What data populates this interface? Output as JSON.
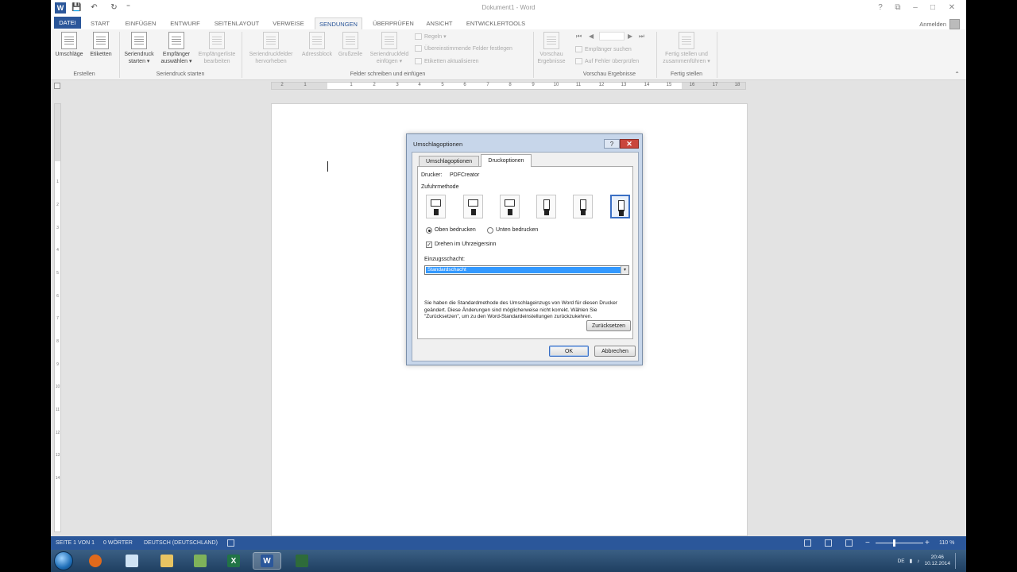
{
  "window": {
    "title": "Dokument1 - Word",
    "signin": "Anmelden",
    "word_logo": "W",
    "qat": [
      "save-icon",
      "undo-icon",
      "redo-icon",
      "customize-icon"
    ]
  },
  "tabs": [
    {
      "label": "DATEI"
    },
    {
      "label": "START"
    },
    {
      "label": "EINFÜGEN"
    },
    {
      "label": "ENTWURF"
    },
    {
      "label": "SEITENLAYOUT"
    },
    {
      "label": "VERWEISE"
    },
    {
      "label": "SENDUNGEN"
    },
    {
      "label": "ÜBERPRÜFEN"
    },
    {
      "label": "ANSICHT"
    },
    {
      "label": "ENTWICKLERTOOLS"
    }
  ],
  "ribbon": {
    "create": {
      "envelopes": "Umschläge",
      "labels": "Etiketten",
      "group": "Erstellen"
    },
    "start_mail_merge": {
      "start": "Seriendruck starten ▾",
      "select_recipients": "Empfänger auswählen ▾",
      "edit_recipients": "Empfängerliste bearbeiten",
      "group": "Seriendruck starten"
    },
    "write_insert": {
      "highlight_fields": "Seriendruckfelder hervorheben",
      "address_block": "Adressblock",
      "greeting_line": "Grußzeile",
      "insert_field": "Seriendruckfeld einfügen ▾",
      "rules": "Regeln ▾",
      "match_fields": "Übereinstimmende Felder festlegen",
      "update_labels": "Etiketten aktualisieren",
      "group": "Felder schreiben und einfügen"
    },
    "preview": {
      "preview_results": "Vorschau Ergebnisse",
      "find_recipient": "Empfänger suchen",
      "check_errors": "Auf Fehler überprüfen",
      "group": "Vorschau Ergebnisse"
    },
    "finish": {
      "finish_merge": "Fertig stellen und zusammenführen ▾",
      "group": "Fertig stellen"
    }
  },
  "ruler": {
    "numbers": [
      "2",
      "1",
      "1",
      "2",
      "3",
      "4",
      "5",
      "6",
      "7",
      "8",
      "9",
      "10",
      "11",
      "12",
      "13",
      "14",
      "15",
      "16",
      "17",
      "18"
    ],
    "vnumbers": [
      "1",
      "2",
      "3",
      "4",
      "5",
      "6",
      "7",
      "8",
      "9",
      "10",
      "11",
      "12",
      "13",
      "14"
    ]
  },
  "statusbar": {
    "page": "SEITE 1 VON 1",
    "words": "0 WÖRTER",
    "language": "DEUTSCH (DEUTSCHLAND)",
    "zoom": "110 %"
  },
  "dialog": {
    "title": "Umschlagoptionen",
    "help": "?",
    "close": "✕",
    "tabs": [
      "Umschlagoptionen",
      "Druckoptionen"
    ],
    "printer_label": "Drucker:",
    "printer_value": "PDFCreator",
    "feed_label": "Zufuhrmethode",
    "feed_selected_index": 5,
    "face_up": "Oben bedrucken",
    "face_down": "Unten bedrucken",
    "face_up_selected": true,
    "clockwise": "Drehen im Uhrzeigersinn",
    "clockwise_checked": true,
    "check_mark": "✓",
    "tray_label": "Einzugsschacht:",
    "tray_value": "Standardschacht",
    "tray_arrow": "▾",
    "info": "Sie haben die Standardmethode des Umschlageinzugs von Word für diesen Drucker geändert. Diese Änderungen sind möglicherweise nicht korrekt. Wählen Sie \"Zurücksetzen\", um zu den Word-Standardeinstellungen zurückzukehren.",
    "reset": "Zurücksetzen",
    "ok": "OK",
    "cancel": "Abbrechen"
  },
  "taskbar": {
    "apps": [
      "ie-icon",
      "firefox-icon",
      "notepad-icon",
      "explorer-icon",
      "paint-icon",
      "excel-icon",
      "word-icon",
      "camtasia-icon"
    ],
    "active_app": "word-icon",
    "lang": "DE",
    "time": "20:46",
    "date": "10.12.2014"
  }
}
